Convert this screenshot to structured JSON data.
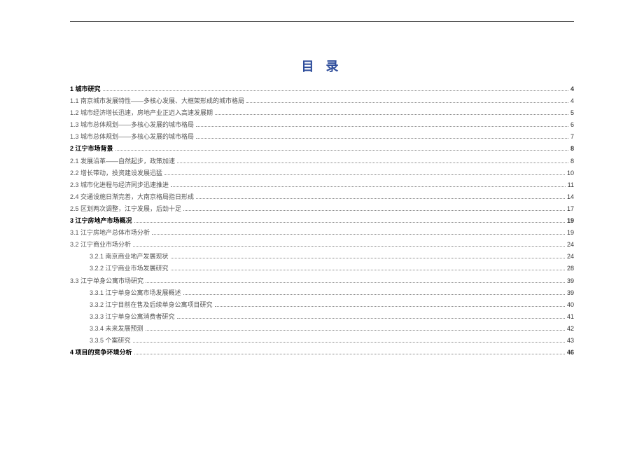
{
  "title": "目 录",
  "entries": [
    {
      "level": "section",
      "label": "1 城市研究",
      "page": "4"
    },
    {
      "level": "sub1",
      "label": "1.1 南京城市发展特性——多核心发展、大框架形成的城市格局",
      "page": "4"
    },
    {
      "level": "sub1",
      "label": "1.2 城市经济增长迅速，房地产业正迈入高速发展期",
      "page": "5"
    },
    {
      "level": "sub1",
      "label": "1.3 城市总体规划——多核心发展的城市格局",
      "page": "6"
    },
    {
      "level": "sub1",
      "label": "1.3 城市总体规划——多核心发展的城市格局",
      "page": "7"
    },
    {
      "level": "section",
      "label": "2 江宁市场背景",
      "page": "8"
    },
    {
      "level": "sub1",
      "label": "2.1 发展沿革——自然起步，政策加速",
      "page": "8"
    },
    {
      "level": "sub1",
      "label": "2.2 增长带动，投资建设发展迅猛",
      "page": "10"
    },
    {
      "level": "sub1",
      "label": "2.3 城市化进程与经济同步迅速推进",
      "page": "11"
    },
    {
      "level": "sub1",
      "label": "2.4 交通设施日渐完善，大南京格局指日形成",
      "page": "14"
    },
    {
      "level": "sub1",
      "label": "2.5 区划两次调整，江宁发展，后劲十足",
      "page": "17"
    },
    {
      "level": "section",
      "label": "3 江宁房地产市场概况",
      "page": "19"
    },
    {
      "level": "sub1",
      "label": "3.1 江宁房地产总体市场分析",
      "page": "19"
    },
    {
      "level": "sub1",
      "label": "3.2 江宁商业市场分析",
      "page": "24"
    },
    {
      "level": "sub2",
      "label": "3.2.1 南京商业地产发展现状",
      "page": "24"
    },
    {
      "level": "sub2",
      "label": "3.2.2 江宁商业市场发展研究",
      "page": "28"
    },
    {
      "level": "sub1",
      "label": "3.3 江宁单身公寓市场研究",
      "page": "39"
    },
    {
      "level": "sub2",
      "label": "3.3.1 江宁单身公寓市场发展概述",
      "page": "39"
    },
    {
      "level": "sub2",
      "label": "3.3.2 江宁目前在售及后续单身公寓项目研究",
      "page": "40"
    },
    {
      "level": "sub2",
      "label": "3.3.3 江宁单身公寓消费者研究",
      "page": "41"
    },
    {
      "level": "sub2",
      "label": "3.3.4 未来发展预测",
      "page": "42"
    },
    {
      "level": "sub2",
      "label": "3.3.5 个案研究",
      "page": "43"
    },
    {
      "level": "section",
      "label": "4 项目的竞争环境分析",
      "page": "46"
    }
  ]
}
